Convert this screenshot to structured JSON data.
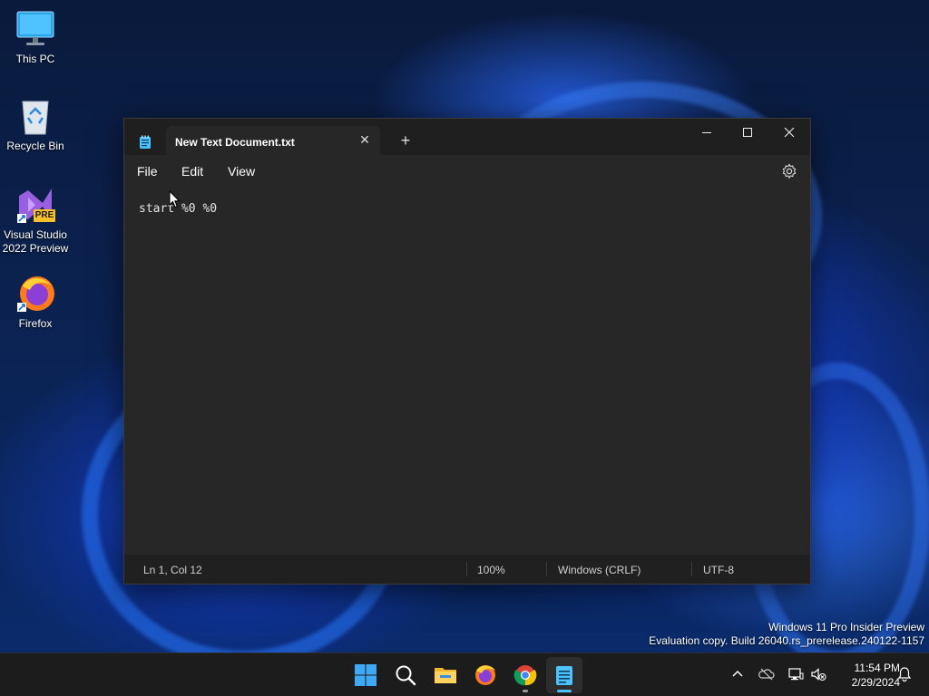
{
  "desktop": {
    "icons": [
      {
        "label": "This PC"
      },
      {
        "label": "Recycle Bin"
      },
      {
        "label_line1": "Visual Studio",
        "label_line2": "2022 Preview",
        "badge": "PRE"
      },
      {
        "label": "Firefox"
      }
    ]
  },
  "notepad": {
    "tab_title": "New Text Document.txt",
    "menu": {
      "file": "File",
      "edit": "Edit",
      "view": "View"
    },
    "content": "start %0 %0",
    "status": {
      "position": "Ln 1, Col 12",
      "zoom": "100%",
      "line_ending": "Windows (CRLF)",
      "encoding": "UTF-8"
    }
  },
  "watermark": {
    "line1": "Windows 11 Pro Insider Preview",
    "line2": "Evaluation copy. Build 26040.rs_prerelease.240122-1157"
  },
  "taskbar": {
    "time": "11:54 PM",
    "date": "2/29/2024"
  },
  "colors": {
    "accent": "#4cc2ff",
    "window_bg": "#272727",
    "titlebar_bg": "#1f1f1f",
    "taskbar_bg": "#1c1c1c"
  }
}
